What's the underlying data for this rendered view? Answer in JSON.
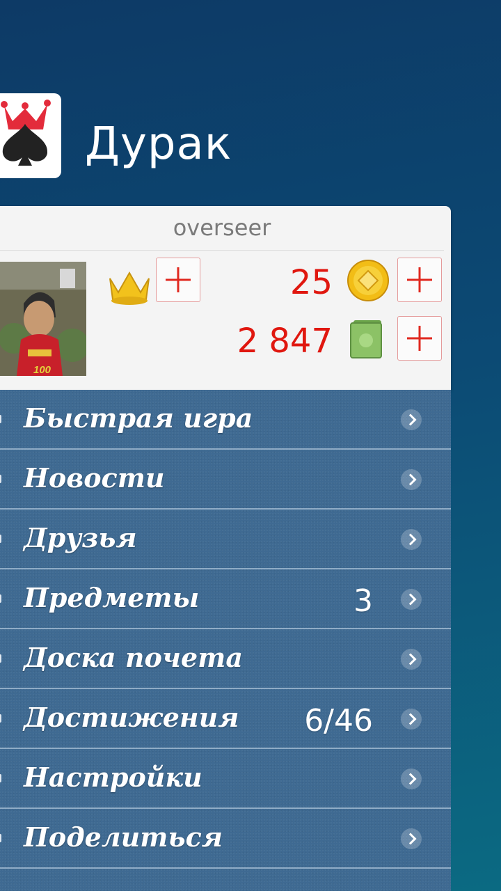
{
  "app": {
    "title": "Дурак"
  },
  "profile": {
    "username": "overseer",
    "avatar_badge": "100",
    "coins": "25",
    "cash": "2 847"
  },
  "menu": {
    "items": [
      {
        "label": "Быстрая игра",
        "value": ""
      },
      {
        "label": "Новости",
        "value": ""
      },
      {
        "label": "Друзья",
        "value": ""
      },
      {
        "label": "Предметы",
        "value": "3"
      },
      {
        "label": "Доска почета",
        "value": ""
      },
      {
        "label": "Достижения",
        "value": "6/46"
      },
      {
        "label": "Настройки",
        "value": ""
      },
      {
        "label": "Поделиться",
        "value": ""
      }
    ]
  },
  "colors": {
    "accent_red": "#e0170f",
    "menu_bg": "#3f6a92",
    "gold": "#f2c21c"
  },
  "icons": {
    "app": "spade-crown-icon",
    "crown": "crown-icon",
    "coin": "coin-icon",
    "cash": "cash-icon",
    "plus": "plus-icon",
    "chevron": "chevron-right-icon"
  }
}
